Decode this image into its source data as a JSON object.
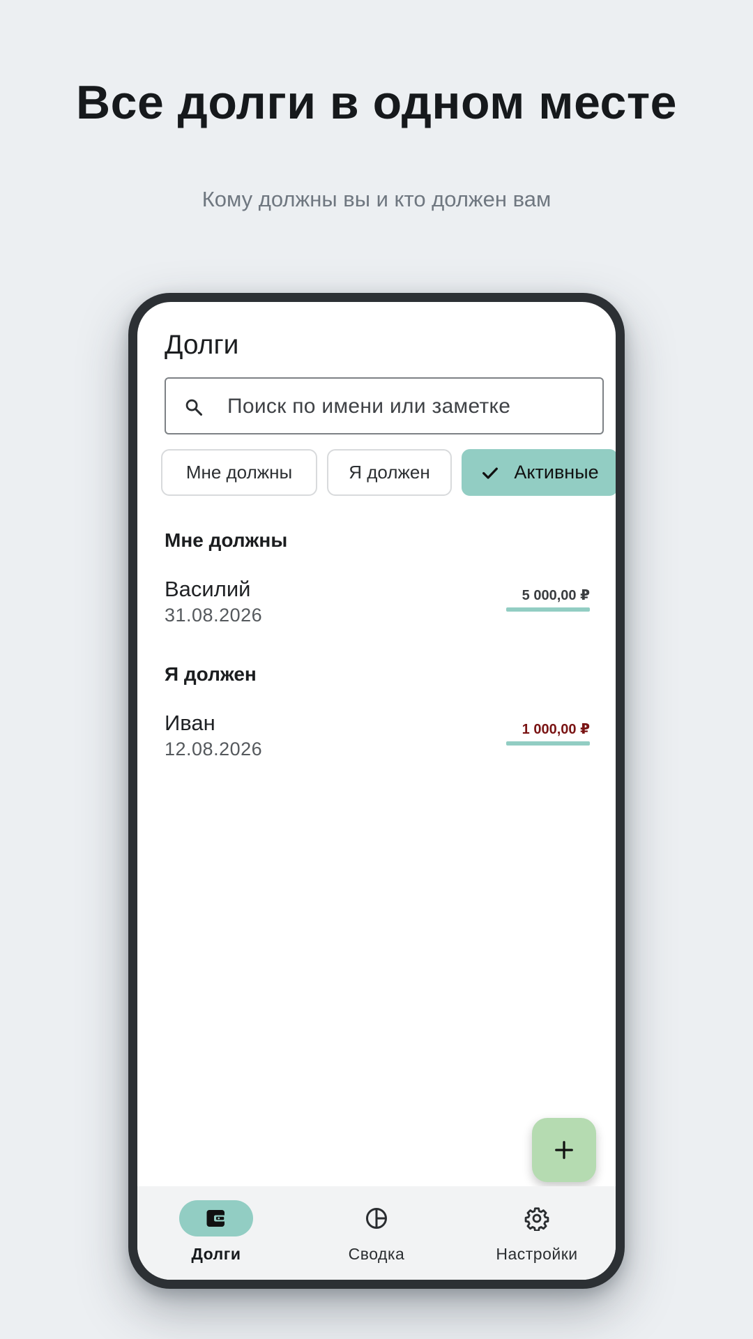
{
  "hero": {
    "title": "Все долги в одном месте",
    "subtitle": "Кому должны вы и кто должен вам"
  },
  "app": {
    "title": "Долги",
    "search_placeholder": "Поиск по имени или заметке",
    "filters": [
      {
        "label": "Мне должны",
        "selected": false
      },
      {
        "label": "Я должен",
        "selected": false
      },
      {
        "label": "Активные",
        "selected": true
      }
    ],
    "sections": [
      {
        "title": "Мне должны",
        "items": [
          {
            "name": "Василий",
            "date": "31.08.2026",
            "amount": "5 000,00 ₽"
          }
        ]
      },
      {
        "title": "Я должен",
        "items": [
          {
            "name": "Иван",
            "date": "12.08.2026",
            "amount": "1 000,00 ₽"
          }
        ]
      }
    ],
    "fab_icon": "plus-icon",
    "bottom_nav": [
      {
        "label": "Долги",
        "icon": "wallet-icon",
        "active": true
      },
      {
        "label": "Сводка",
        "icon": "pie-chart-icon",
        "active": false
      },
      {
        "label": "Настройки",
        "icon": "gear-icon",
        "active": false
      }
    ]
  },
  "colors": {
    "accent": "#92cdc3",
    "fab": "#b5dbb1",
    "background": "#eceff2",
    "frame": "#2c3034",
    "negative_amount": "#7a1414"
  }
}
